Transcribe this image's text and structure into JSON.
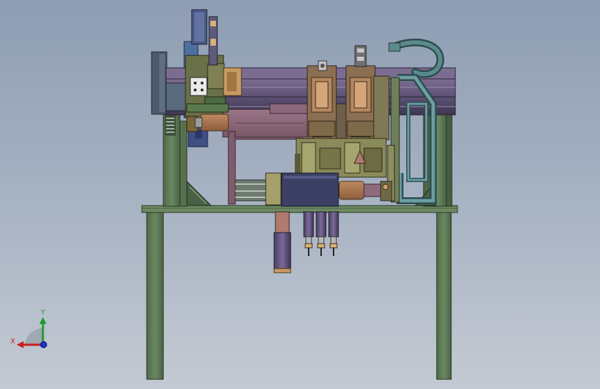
{
  "triad": {
    "x_label": "X",
    "y_label": "Y",
    "x_color": "#c81e1e",
    "y_color": "#1e9b2a",
    "z_color": "#1a2fd6"
  },
  "palette": {
    "frame_green": "#5d7a55",
    "frame_dark": "#2f3d2c",
    "rail_purple": "#6e5f86",
    "rail_dark": "#3a3346",
    "mauve": "#8f6a7c",
    "olive": "#8a8a5a",
    "tan": "#a8865a",
    "navy": "#3b3f63",
    "teal": "#3f6e74",
    "copper": "#b07a55"
  }
}
